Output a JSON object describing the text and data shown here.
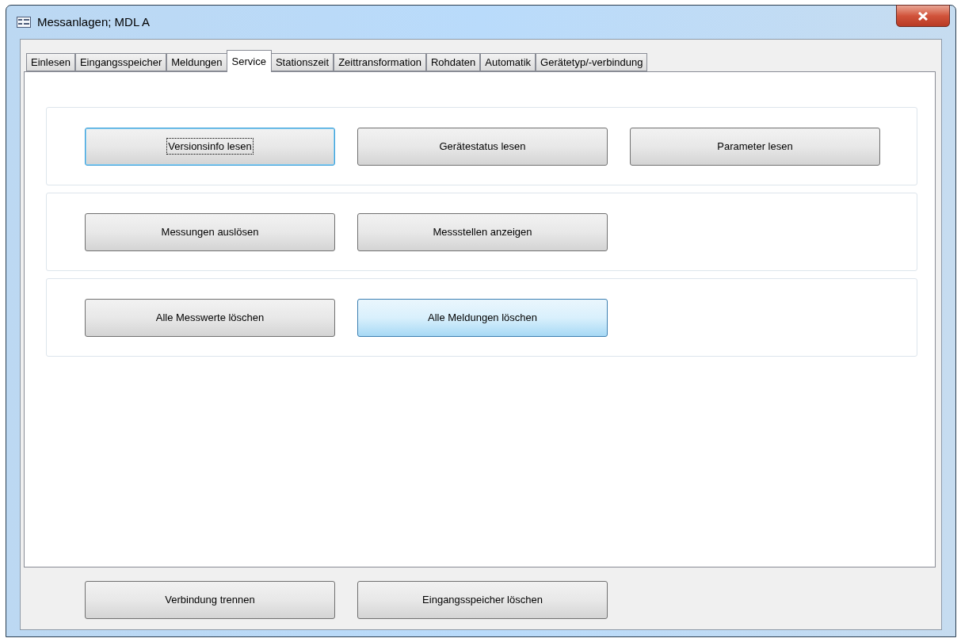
{
  "window": {
    "title": "Messanlagen; MDL A"
  },
  "tabs": [
    {
      "label": "Einlesen",
      "selected": false
    },
    {
      "label": "Eingangsspeicher",
      "selected": false
    },
    {
      "label": "Meldungen",
      "selected": false
    },
    {
      "label": "Service",
      "selected": true
    },
    {
      "label": "Stationszeit",
      "selected": false
    },
    {
      "label": "Zeittransformation",
      "selected": false
    },
    {
      "label": "Rohdaten",
      "selected": false
    },
    {
      "label": "Automatik",
      "selected": false
    },
    {
      "label": "Gerätetyp/-verbindung",
      "selected": false
    }
  ],
  "groups": [
    {
      "buttons": [
        {
          "label": "Versionsinfo lesen",
          "focused": true,
          "hovered": false
        },
        {
          "label": "Gerätestatus lesen",
          "focused": false,
          "hovered": false
        },
        {
          "label": "Parameter lesen",
          "focused": false,
          "hovered": false
        }
      ]
    },
    {
      "buttons": [
        {
          "label": "Messungen auslösen",
          "focused": false,
          "hovered": false
        },
        {
          "label": "Messstellen anzeigen",
          "focused": false,
          "hovered": false
        }
      ]
    },
    {
      "buttons": [
        {
          "label": "Alle Messwerte löschen",
          "focused": false,
          "hovered": false
        },
        {
          "label": "Alle Meldungen löschen",
          "focused": false,
          "hovered": true
        }
      ]
    }
  ],
  "footer_buttons": [
    {
      "label": "Verbindung trennen",
      "focused": false,
      "hovered": false
    },
    {
      "label": "Eingangsspeicher löschen",
      "focused": false,
      "hovered": false
    }
  ]
}
